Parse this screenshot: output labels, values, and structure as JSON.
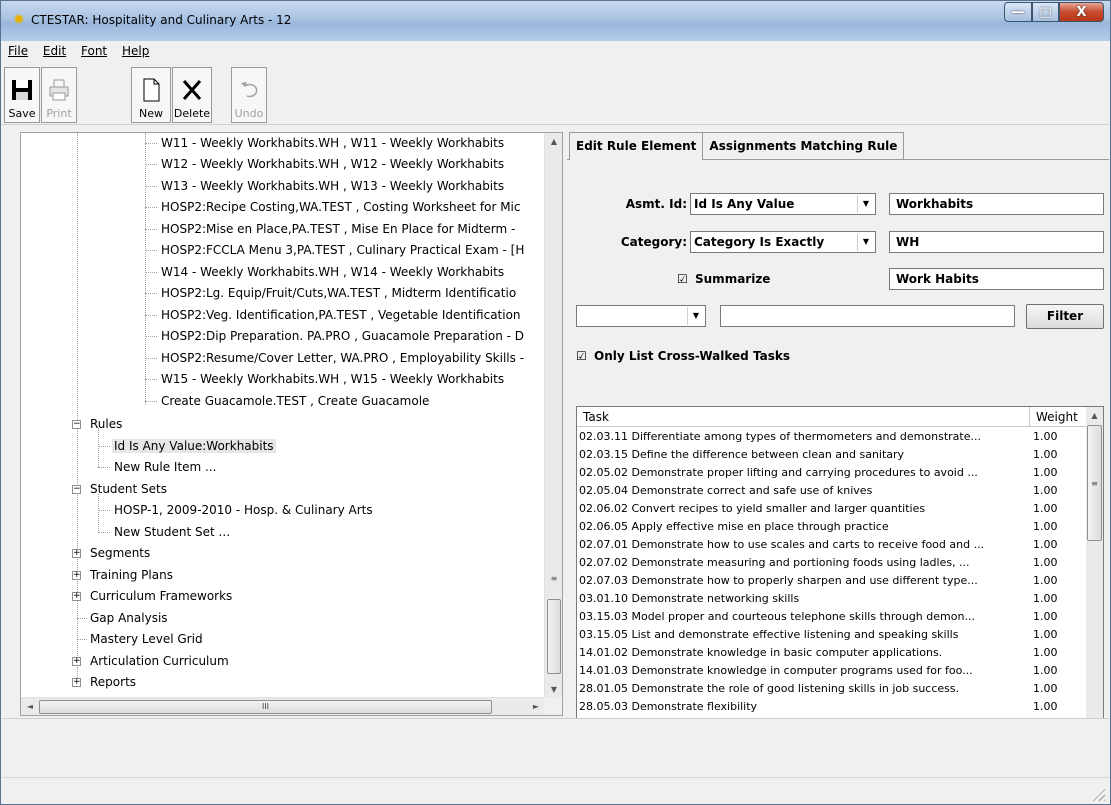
{
  "window": {
    "title": "CTESTAR: Hospitality and Culinary Arts - 12",
    "controls": {
      "minimize": "—",
      "maximize": "□",
      "close": "X"
    }
  },
  "menu": [
    "File",
    "Edit",
    "Font",
    "Help"
  ],
  "toolbar": {
    "save": "Save",
    "print": "Print",
    "new": "New",
    "delete": "Delete",
    "undo": "Undo"
  },
  "tree": {
    "assignments": [
      "W11 - Weekly Workhabits.WH , W11 - Weekly Workhabits",
      "W12 - Weekly Workhabits.WH , W12 - Weekly Workhabits",
      "W13 - Weekly Workhabits.WH , W13 - Weekly Workhabits",
      "HOSP2:Recipe Costing,WA.TEST , Costing Worksheet for Mic",
      "HOSP2:Mise en Place,PA.TEST , Mise En Place for Midterm -",
      "HOSP2:FCCLA Menu 3,PA.TEST , Culinary Practical Exam - [H",
      "W14 - Weekly Workhabits.WH , W14 - Weekly Workhabits",
      "HOSP2:Lg. Equip/Fruit/Cuts,WA.TEST , Midterm Identificatio",
      "HOSP2:Veg. Identification,PA.TEST , Vegetable Identification",
      "HOSP2:Dip Preparation. PA.PRO , Guacamole Preparation - D",
      "HOSP2:Resume/Cover Letter, WA.PRO , Employability Skills -",
      "W15 - Weekly Workhabits.WH , W15 - Weekly Workhabits",
      "Create Guacamole.TEST , Create Guacamole"
    ],
    "rules_label": "Rules",
    "rule_items": [
      "Id Is Any Value:Workhabits",
      "New Rule Item ..."
    ],
    "student_sets_label": "Student Sets",
    "student_set_items": [
      "HOSP-1, 2009-2010 - Hosp. & Culinary Arts",
      "New Student Set ..."
    ],
    "segments": "Segments",
    "training_plans": "Training Plans",
    "curriculum_frameworks": "Curriculum Frameworks",
    "gap_analysis": "Gap Analysis",
    "mastery_level_grid": "Mastery Level Grid",
    "articulation_curriculum": "Articulation Curriculum",
    "reports": "Reports",
    "expand_plus": "+",
    "collapse_minus": "−"
  },
  "tabs": [
    "Edit Rule Element",
    "Assignments Matching Rule"
  ],
  "form": {
    "asmt_label": "Asmt. Id:",
    "asmt_combo": "Id Is Any Value",
    "asmt_value": "Workhabits",
    "category_label": "Category:",
    "category_combo": "Category Is Exactly",
    "category_value": "WH",
    "summarize_label": "Summarize",
    "summarize_checked": "☑",
    "summarize_value": "Work Habits",
    "filter_combo": "",
    "filter_text": "",
    "filter_button": "Filter",
    "only_crosswalked_label": "Only List Cross-Walked Tasks",
    "only_crosswalked_checked": "☑"
  },
  "grid": {
    "headers": [
      "Task",
      "Weight"
    ],
    "rows": [
      [
        "02.03.11 Differentiate among types of thermometers and demonstrate...",
        "1.00"
      ],
      [
        "02.03.15 Define the difference between clean and sanitary",
        "1.00"
      ],
      [
        "02.05.02 Demonstrate proper lifting and carrying procedures to avoid ...",
        "1.00"
      ],
      [
        "02.05.04 Demonstrate correct and safe use of knives",
        "1.00"
      ],
      [
        "02.06.02 Convert recipes to yield smaller and larger quantities",
        "1.00"
      ],
      [
        "02.06.05 Apply effective mise en place through practice",
        "1.00"
      ],
      [
        "02.07.01 Demonstrate how to use scales and carts to receive food and ...",
        "1.00"
      ],
      [
        "02.07.02 Demonstrate measuring and portioning foods using ladles, ...",
        "1.00"
      ],
      [
        "02.07.03 Demonstrate how to properly sharpen and use different type...",
        "1.00"
      ],
      [
        "03.01.10 Demonstrate networking skills",
        "1.00"
      ],
      [
        "03.15.03 Model proper and courteous telephone skills through demon...",
        "1.00"
      ],
      [
        "03.15.05 List and demonstrate effective listening and speaking skills",
        "1.00"
      ],
      [
        "14.01.02 Demonstrate knowledge in basic computer applications.",
        "1.00"
      ],
      [
        "14.01.03 Demonstrate knowledge in computer programs used for foo...",
        "1.00"
      ],
      [
        "28.01.05 Demonstrate the role of good listening skills in job success.",
        "1.00"
      ],
      [
        "28.05.03 Demonstrate flexibility",
        "1.00"
      ]
    ]
  },
  "scroll": {
    "up": "▲",
    "down": "▼",
    "left": "◄",
    "right": "►",
    "grip": "≡",
    "hgrip": "III"
  }
}
